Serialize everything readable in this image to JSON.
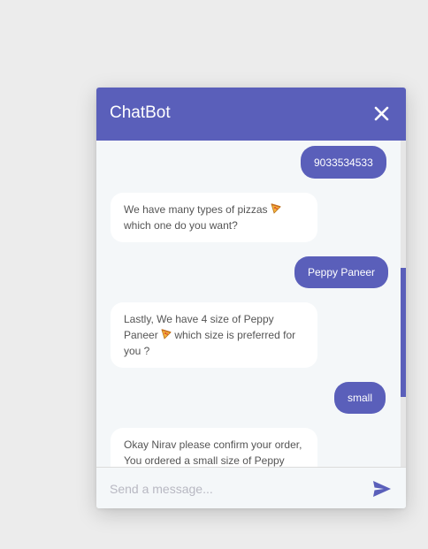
{
  "header": {
    "title": "ChatBot"
  },
  "icons": {
    "close": "close-icon",
    "send": "send-icon",
    "pizza": "pizza-emoji-icon"
  },
  "colors": {
    "accent": "#5a5fba",
    "background": "#f4f7f9",
    "bot_bubble": "#ffffff",
    "bot_text": "#555555"
  },
  "messages": [
    {
      "sender": "user",
      "text": "9033534533"
    },
    {
      "sender": "bot",
      "parts": [
        "We have many types of pizzas",
        "which one do you want?"
      ]
    },
    {
      "sender": "user",
      "text": "Peppy Paneer"
    },
    {
      "sender": "bot",
      "parts": [
        "Lastly, We have 4 size of Peppy Paneer",
        "which size is preferred for you ?"
      ]
    },
    {
      "sender": "user",
      "text": "small"
    },
    {
      "sender": "bot",
      "text": "Okay Nirav please confirm your order, You ordered a small size of Peppy"
    }
  ],
  "composer": {
    "placeholder": "Send a message..."
  }
}
